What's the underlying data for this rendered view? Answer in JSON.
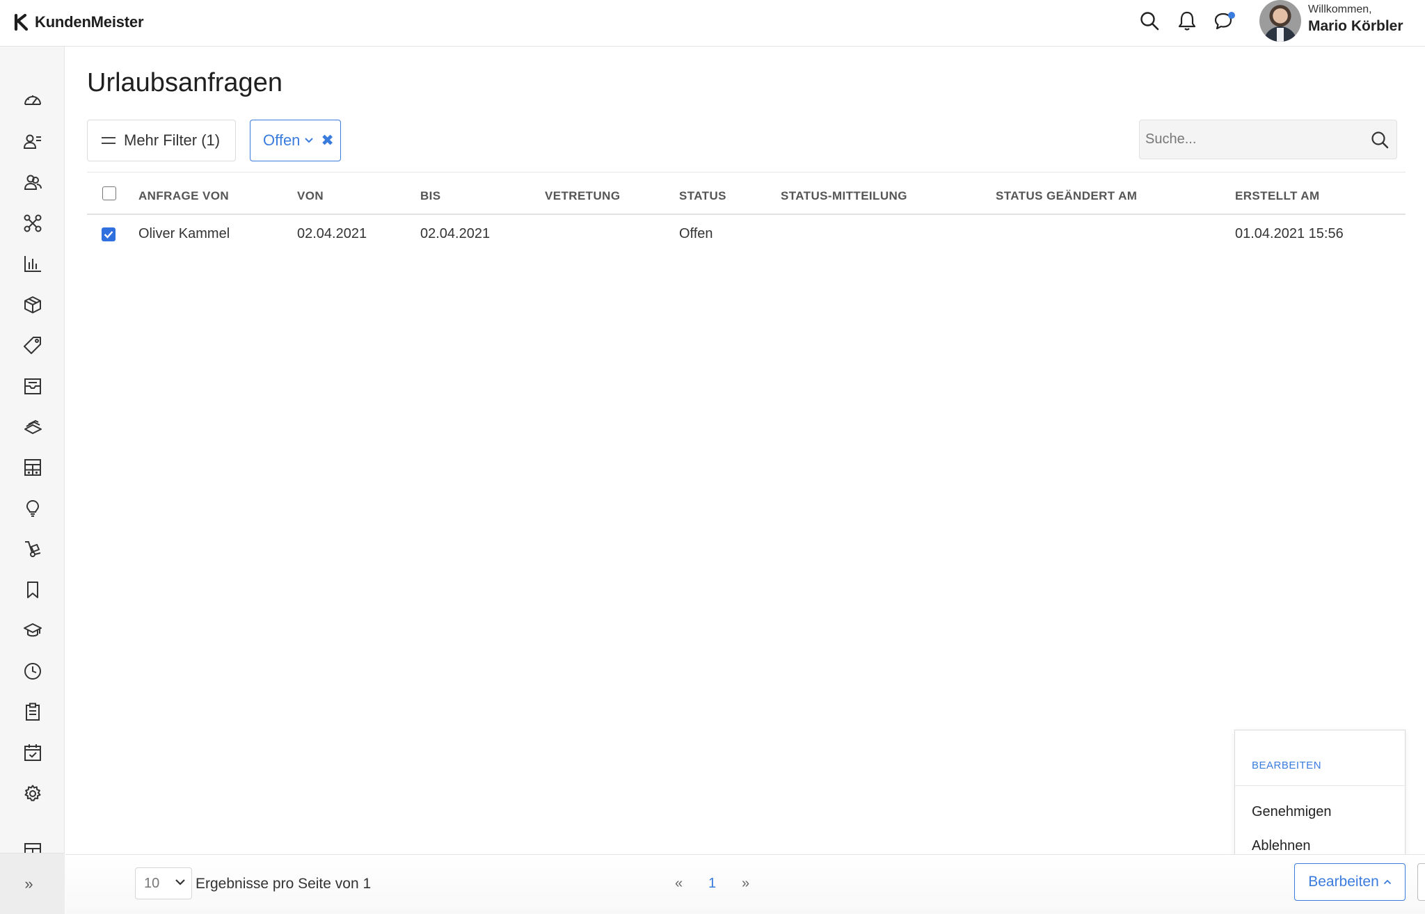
{
  "app": {
    "name": "KundenMeister"
  },
  "header": {
    "welcome_label": "Willkommen,",
    "user_name": "Mario Körbler"
  },
  "sidebar": {
    "items": [
      "dashboard-icon",
      "contacts-icon",
      "groups-icon",
      "network-icon",
      "statistics-icon",
      "products-icon",
      "tags-icon",
      "inbox-icon",
      "stack-icon",
      "calculator-icon",
      "ideas-icon",
      "delivery-icon",
      "bookmark-icon",
      "training-icon",
      "time-icon",
      "clipboard-icon",
      "calendar-icon",
      "settings-icon",
      "calculator-icon"
    ],
    "expand_label": "»"
  },
  "page": {
    "title": "Urlaubsanfragen"
  },
  "filters": {
    "more_filters_label": "Mehr Filter (1)",
    "active_chip_label": "Offen",
    "remove_chip_label": "✖"
  },
  "search": {
    "placeholder": "Suche..."
  },
  "table": {
    "headers": [
      "ANFRAGE VON",
      "VON",
      "BIS",
      "VETRETUNG",
      "STATUS",
      "STATUS-MITTEILUNG",
      "STATUS GEÄNDERT AM",
      "ERSTELLT AM"
    ],
    "rows": [
      {
        "checked": true,
        "anfrage_von": "Oliver Kammel",
        "von": "02.04.2021",
        "bis": "02.04.2021",
        "vetretung": "",
        "status": "Offen",
        "status_mitteilung": "",
        "status_geaendert_am": "",
        "erstellt_am": "01.04.2021 15:56"
      }
    ]
  },
  "menu": {
    "header": "BEARBEITEN",
    "items": [
      "Genehmigen",
      "Ablehnen"
    ]
  },
  "footer": {
    "page_size": "10",
    "results_label": "Ergebnisse pro Seite von 1",
    "prev": "«",
    "current_page": "1",
    "next": "»",
    "edit_button_label": "Bearbeiten"
  },
  "colors": {
    "accent": "#3a7bde",
    "checkbox": "#2f6fde",
    "notification_dot": "#3a7bde"
  }
}
